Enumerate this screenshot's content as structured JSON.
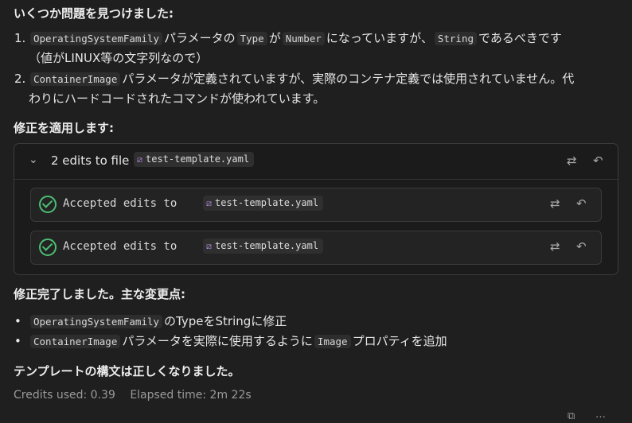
{
  "intro": "いくつか問題を見つけました:",
  "issues": [
    {
      "code1": "OperatingSystemFamily",
      "t1": "パラメータの",
      "code2": "Type",
      "t2": "が",
      "code3": "Number",
      "t3": "になっていますが、",
      "code4": "String",
      "t4": "であるべきです",
      "t5": "（値がLINUX等の文字列なので）"
    },
    {
      "code1": "ContainerImage",
      "t1": "パラメータが定義されていますが、実際のコンテナ定義では使用されていません。代",
      "t2": "わりにハードコードされたコマンドが使われています。"
    }
  ],
  "apply_heading": "修正を適用します:",
  "edit_card": {
    "title": "2 edits to file",
    "filename": "test-template.yaml",
    "rows": [
      {
        "text": "Accepted edits to",
        "filename": "test-template.yaml"
      },
      {
        "text": "Accepted edits to",
        "filename": "test-template.yaml"
      }
    ]
  },
  "done_heading": "修正完了しました。主な変更点:",
  "changes": [
    {
      "code": "OperatingSystemFamily",
      "text": "のTypeをStringに修正"
    },
    {
      "code": "ContainerImage",
      "text1": "パラメータを実際に使用するように",
      "code2": "Image",
      "text2": "プロパティを追加"
    }
  ],
  "conclusion": "テンプレートの構文は正しくなりました。",
  "footer": {
    "credits": "Credits used: 0.39",
    "elapsed": "Elapsed time: 2m 22s"
  },
  "icons": [
    "chevron-down-icon",
    "file-icon",
    "compare-icon",
    "undo-icon",
    "check-circle-icon",
    "copy-icon",
    "more-icon"
  ]
}
